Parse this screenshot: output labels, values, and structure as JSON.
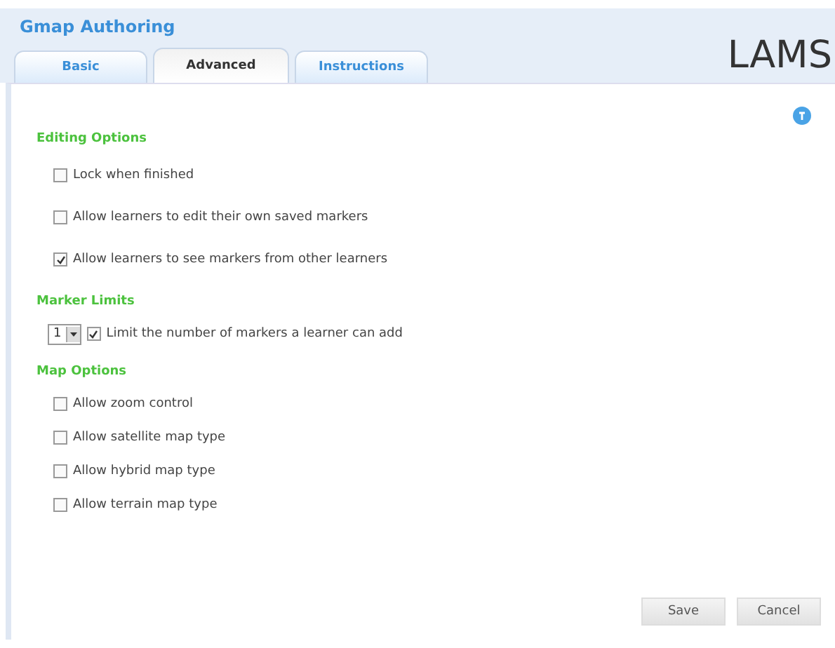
{
  "title": "Gmap Authoring",
  "logo": "LAMS",
  "tabs": [
    {
      "label": "Basic",
      "selected": false
    },
    {
      "label": "Advanced",
      "selected": true
    },
    {
      "label": "Instructions",
      "selected": false
    }
  ],
  "sections": [
    {
      "heading": "Editing Options",
      "options": [
        {
          "kind": "checkbox",
          "label": "Lock when finished",
          "checked": false
        },
        {
          "kind": "checkbox",
          "label": "Allow learners to edit their own saved markers",
          "checked": false
        },
        {
          "kind": "checkbox",
          "label": "Allow learners to see markers from other learners",
          "checked": true
        }
      ]
    },
    {
      "heading": "Marker Limits",
      "options": [
        {
          "kind": "limit",
          "select_value": "1",
          "label": "Limit the number of markers a learner can add",
          "checked": true
        }
      ]
    },
    {
      "heading": "Map Options",
      "options": [
        {
          "kind": "checkbox",
          "label": "Allow zoom control",
          "checked": false
        },
        {
          "kind": "checkbox",
          "label": "Allow satellite map type",
          "checked": false
        },
        {
          "kind": "checkbox",
          "label": "Allow hybrid map type",
          "checked": false
        },
        {
          "kind": "checkbox",
          "label": "Allow terrain map type",
          "checked": false
        }
      ]
    }
  ],
  "buttons": [
    "Save",
    "Cancel"
  ]
}
